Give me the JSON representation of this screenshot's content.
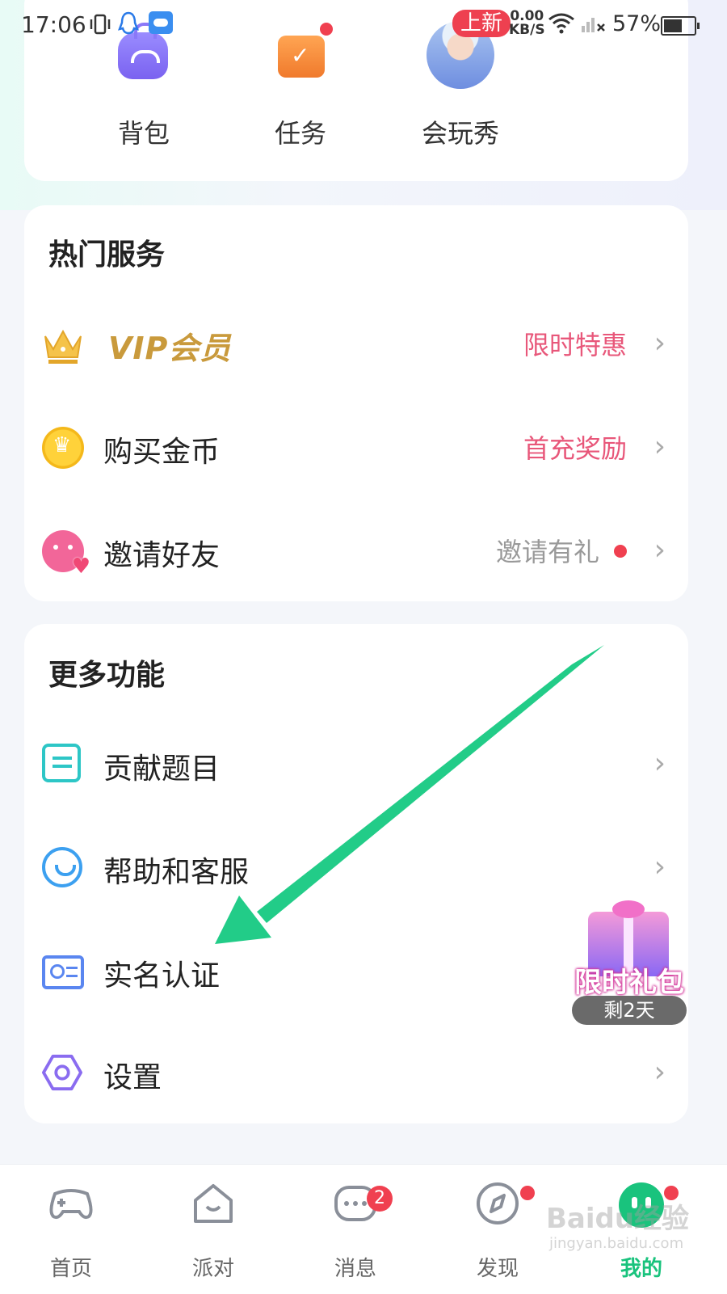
{
  "status_bar": {
    "time": "17:06",
    "new_badge": "上新",
    "speed_value": "0.00",
    "speed_unit": "KB/S",
    "battery": "57%"
  },
  "quick_actions": [
    {
      "label": "背包",
      "icon": "backpack-icon"
    },
    {
      "label": "任务",
      "icon": "calendar-check-icon"
    },
    {
      "label": "会玩秀",
      "icon": "avatar"
    }
  ],
  "hot_services": {
    "title": "热门服务",
    "items": [
      {
        "label": "VIP会员",
        "extra": "限时特惠",
        "extra_color": "#e8577a",
        "icon": "crown-icon"
      },
      {
        "label": "购买金币",
        "extra": "首充奖励",
        "extra_color": "#e8577a",
        "icon": "coin-icon"
      },
      {
        "label": "邀请好友",
        "extra": "邀请有礼",
        "extra_color": "#999999",
        "icon": "smile-heart-icon"
      }
    ]
  },
  "more_features": {
    "title": "更多功能",
    "items": [
      {
        "label": "贡献题目",
        "icon": "document-icon"
      },
      {
        "label": "帮助和客服",
        "icon": "chat-icon"
      },
      {
        "label": "实名认证",
        "icon": "id-card-icon"
      },
      {
        "label": "设置",
        "icon": "gear-icon"
      }
    ]
  },
  "gift_pack": {
    "title": "限时礼包",
    "remaining": "剩2天"
  },
  "bottom_nav": [
    {
      "label": "首页",
      "icon": "gamepad-icon"
    },
    {
      "label": "派对",
      "icon": "house-smile-icon"
    },
    {
      "label": "消息",
      "icon": "message-icon",
      "badge": "2"
    },
    {
      "label": "发现",
      "icon": "compass-icon"
    },
    {
      "label": "我的",
      "icon": "me-icon",
      "active": true
    }
  ],
  "watermark": {
    "text": "Baidu经验",
    "sub": "jingyan.baidu.com"
  },
  "colors": {
    "accent_green": "#19c37d",
    "badge_red": "#f04050",
    "vip_gold": "#c99a3c",
    "arrow_green": "#22cc88"
  }
}
